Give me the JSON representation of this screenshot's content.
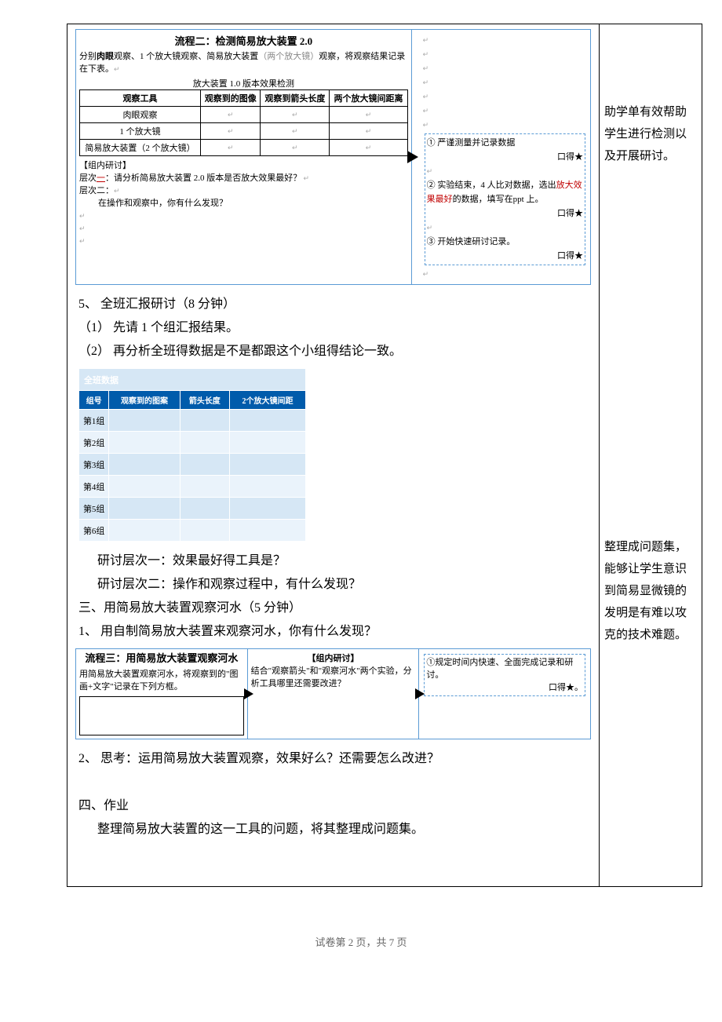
{
  "flow2": {
    "title": "流程二：检测简易放大装置 2.0",
    "desc_prefix": "分别",
    "desc_bold": "肉眼",
    "desc_mid": "观察、1 个放大镜观察、简易放大装置",
    "desc_gray": "（两个放大镜）",
    "desc_suffix": "观察，将观察结果记录在下表。",
    "effect_caption": "放大装置 1.0 版本效果检测",
    "headers": [
      "观察工具",
      "观察到的图像",
      "观察到箭头长度",
      "两个放大镜间距离"
    ],
    "rows": [
      "肉眼观察",
      "1 个放大镜",
      "简易放大装置（2 个放大镜）"
    ],
    "group_title": "【组内研讨】",
    "level1_label": "层次",
    "level1_underline": "一",
    "level1_text": "：请分析简易放大装置 2.0 版本是否放大效果最好？",
    "level2_label": "层次二：",
    "level2_text": "在操作和观察中，你有什么发现？",
    "right_items": [
      "① 严谨测量并记录数据",
      "② 实验结束，4 人比对数据，选出",
      "③ 开始快速研讨记录。"
    ],
    "right_red": "放大效果最好",
    "right_red_suffix": "的数据，填写在ppt 上。",
    "check": "口得★"
  },
  "body": {
    "item5": "5、 全班汇报研讨（8 分钟）",
    "item5_1": "（1）  先请 1 个组汇报结果。",
    "item5_2": "（2）  再分析全班得数据是不是都跟这个小组得结论一致。",
    "class_data_title": "全班数据",
    "class_headers": [
      "组号",
      "观察到的图案",
      "箭头长度",
      "2个放大镜间距"
    ],
    "class_rows": [
      "第1组",
      "第2组",
      "第3组",
      "第4组",
      "第5组",
      "第6组"
    ],
    "discuss1": "研讨层次一：效果最好得工具是？",
    "discuss2": "研讨层次二：操作和观察过程中，有什么发现？",
    "section3": "三、用简易放大装置观察河水（5 分钟）",
    "section3_1": "1、 用自制简易放大装置来观察河水，你有什么发现？"
  },
  "flow3": {
    "title": "流程三：用简易放大装置观察河水",
    "col1": "用简易放大装置观察河水，将观察到的\"图画+文字\"记录在下列方框。",
    "col2_title": "【组内研讨】",
    "col2": "结合\"观察箭头\"和\"观察河水\"两个实验，分析工具哪里还需要改进？",
    "col3_1": "①规定时间内快速、全面完成记录和研讨。",
    "check": "口得★。"
  },
  "body2": {
    "item2": "2、 思考：运用简易放大装置观察，效果好么？还需要怎么改进？",
    "section4": "四、作业",
    "section4_text": "整理简易放大装置的这一工具的问题，将其整理成问题集。"
  },
  "side": {
    "note1": "助学单有效帮助学生进行检测以及开展研讨。",
    "note2": "整理成问题集，能够让学生意识到简易显微镜的发明是有难以攻克的技术难题。"
  },
  "footer": {
    "prefix": "试卷第 ",
    "page": "2",
    "mid": " 页，共 ",
    "total": "7",
    "suffix": " 页"
  }
}
